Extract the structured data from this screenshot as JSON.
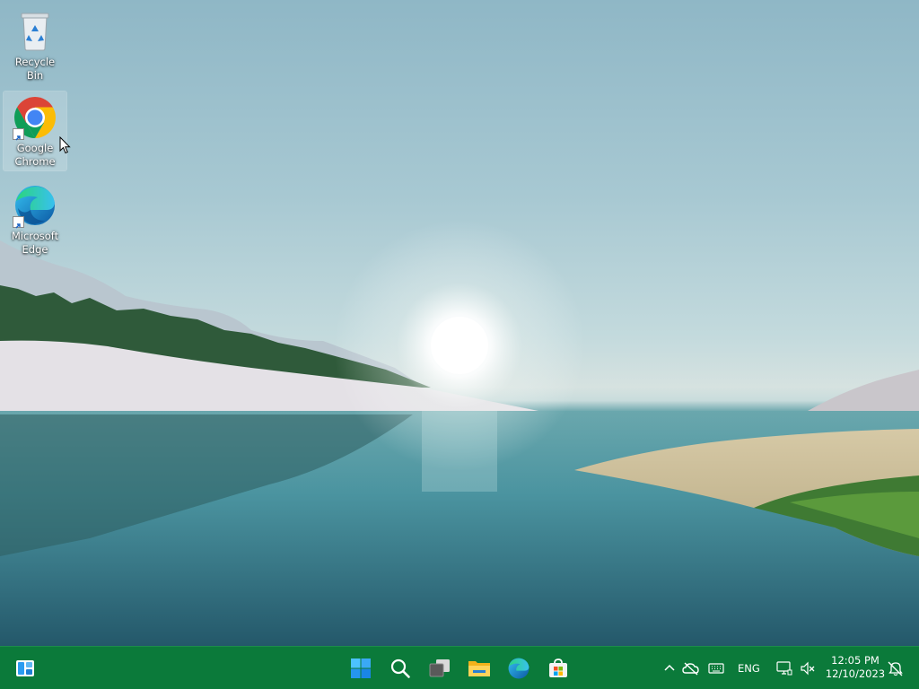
{
  "desktop": {
    "icons": [
      {
        "label": "Recycle Bin",
        "icon": "recycle-bin-icon"
      },
      {
        "label": "Google Chrome",
        "icon": "chrome-icon"
      },
      {
        "label": "Microsoft Edge",
        "icon": "edge-icon"
      }
    ]
  },
  "taskbar": {
    "pinned": [
      {
        "name": "widgets-icon"
      },
      {
        "name": "start-icon"
      },
      {
        "name": "search-icon"
      },
      {
        "name": "task-view-icon"
      },
      {
        "name": "file-explorer-icon"
      },
      {
        "name": "edge-icon"
      },
      {
        "name": "microsoft-store-icon"
      }
    ],
    "tray": {
      "language": "ENG",
      "time": "12:05 PM",
      "date": "12/10/2023"
    }
  },
  "colors": {
    "taskbar": "#0b7a3a",
    "accent": "#0078d4"
  }
}
